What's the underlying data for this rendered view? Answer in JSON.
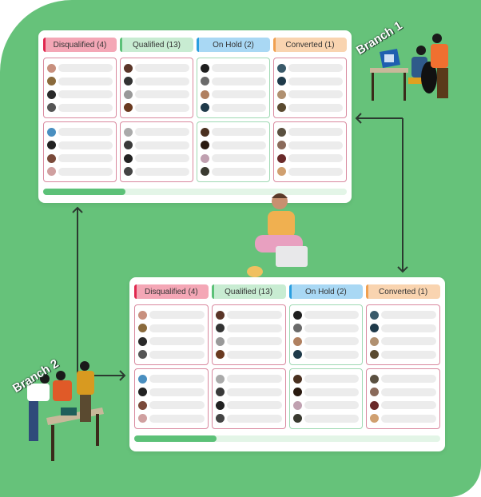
{
  "branches": [
    {
      "label": "Branch 1",
      "columns": [
        {
          "label": "Disqualified (4)",
          "style": "dq",
          "cards": [
            [
              "#c8907e",
              "#8a6a3c",
              "#2a2a2a",
              "#555555"
            ],
            [
              "#4a8fc0",
              "#222222",
              "#7a4a3a",
              "#d0a0a0"
            ]
          ]
        },
        {
          "label": "Qualified (13)",
          "style": "q",
          "cards": [
            [
              "#5a3528",
              "#333333",
              "#999999",
              "#6a3a20"
            ],
            [
              "#aaaaaa",
              "#3a3a3a",
              "#222222",
              "#444444"
            ]
          ]
        },
        {
          "label": "On Hold (2)",
          "style": "oh",
          "cards": [
            [
              "#1e1e1e",
              "#6a6a6a",
              "#b08060",
              "#1f3a4a"
            ],
            [
              "#4a3020",
              "#2a1a10",
              "#c0a0b0",
              "#3a3a30"
            ]
          ]
        },
        {
          "label": "Converted (1)",
          "style": "cv",
          "cards": [
            [
              "#3a5a6a",
              "#1f3a4a",
              "#b09070",
              "#5a4a30"
            ],
            [
              "#5a5040",
              "#8a6a5a",
              "#6a2a2a",
              "#d0a070"
            ]
          ]
        }
      ],
      "progress": 0.27
    },
    {
      "label": "Branch 2",
      "columns": [
        {
          "label": "Disqualified (4)",
          "style": "dq",
          "cards": [
            [
              "#c8907e",
              "#8a6a3c",
              "#2a2a2a",
              "#555555"
            ],
            [
              "#4a8fc0",
              "#222222",
              "#7a4a3a",
              "#d0a0a0"
            ]
          ]
        },
        {
          "label": "Qualified (13)",
          "style": "q",
          "cards": [
            [
              "#5a3528",
              "#333333",
              "#999999",
              "#6a3a20"
            ],
            [
              "#aaaaaa",
              "#3a3a3a",
              "#222222",
              "#444444"
            ]
          ]
        },
        {
          "label": "On Hold (2)",
          "style": "oh",
          "cards": [
            [
              "#1e1e1e",
              "#6a6a6a",
              "#b08060",
              "#1f3a4a"
            ],
            [
              "#4a3020",
              "#2a1a10",
              "#c0a0b0",
              "#3a3a30"
            ]
          ]
        },
        {
          "label": "Converted (1)",
          "style": "cv",
          "cards": [
            [
              "#3a5a6a",
              "#1f3a4a",
              "#b09070",
              "#5a4a30"
            ],
            [
              "#5a5040",
              "#8a6a5a",
              "#6a2a2a",
              "#d0a070"
            ]
          ]
        }
      ],
      "progress": 0.27
    }
  ],
  "colors": {
    "background": "#66c27a",
    "progress": "#5cc178",
    "arrow": "#2b3a30"
  }
}
